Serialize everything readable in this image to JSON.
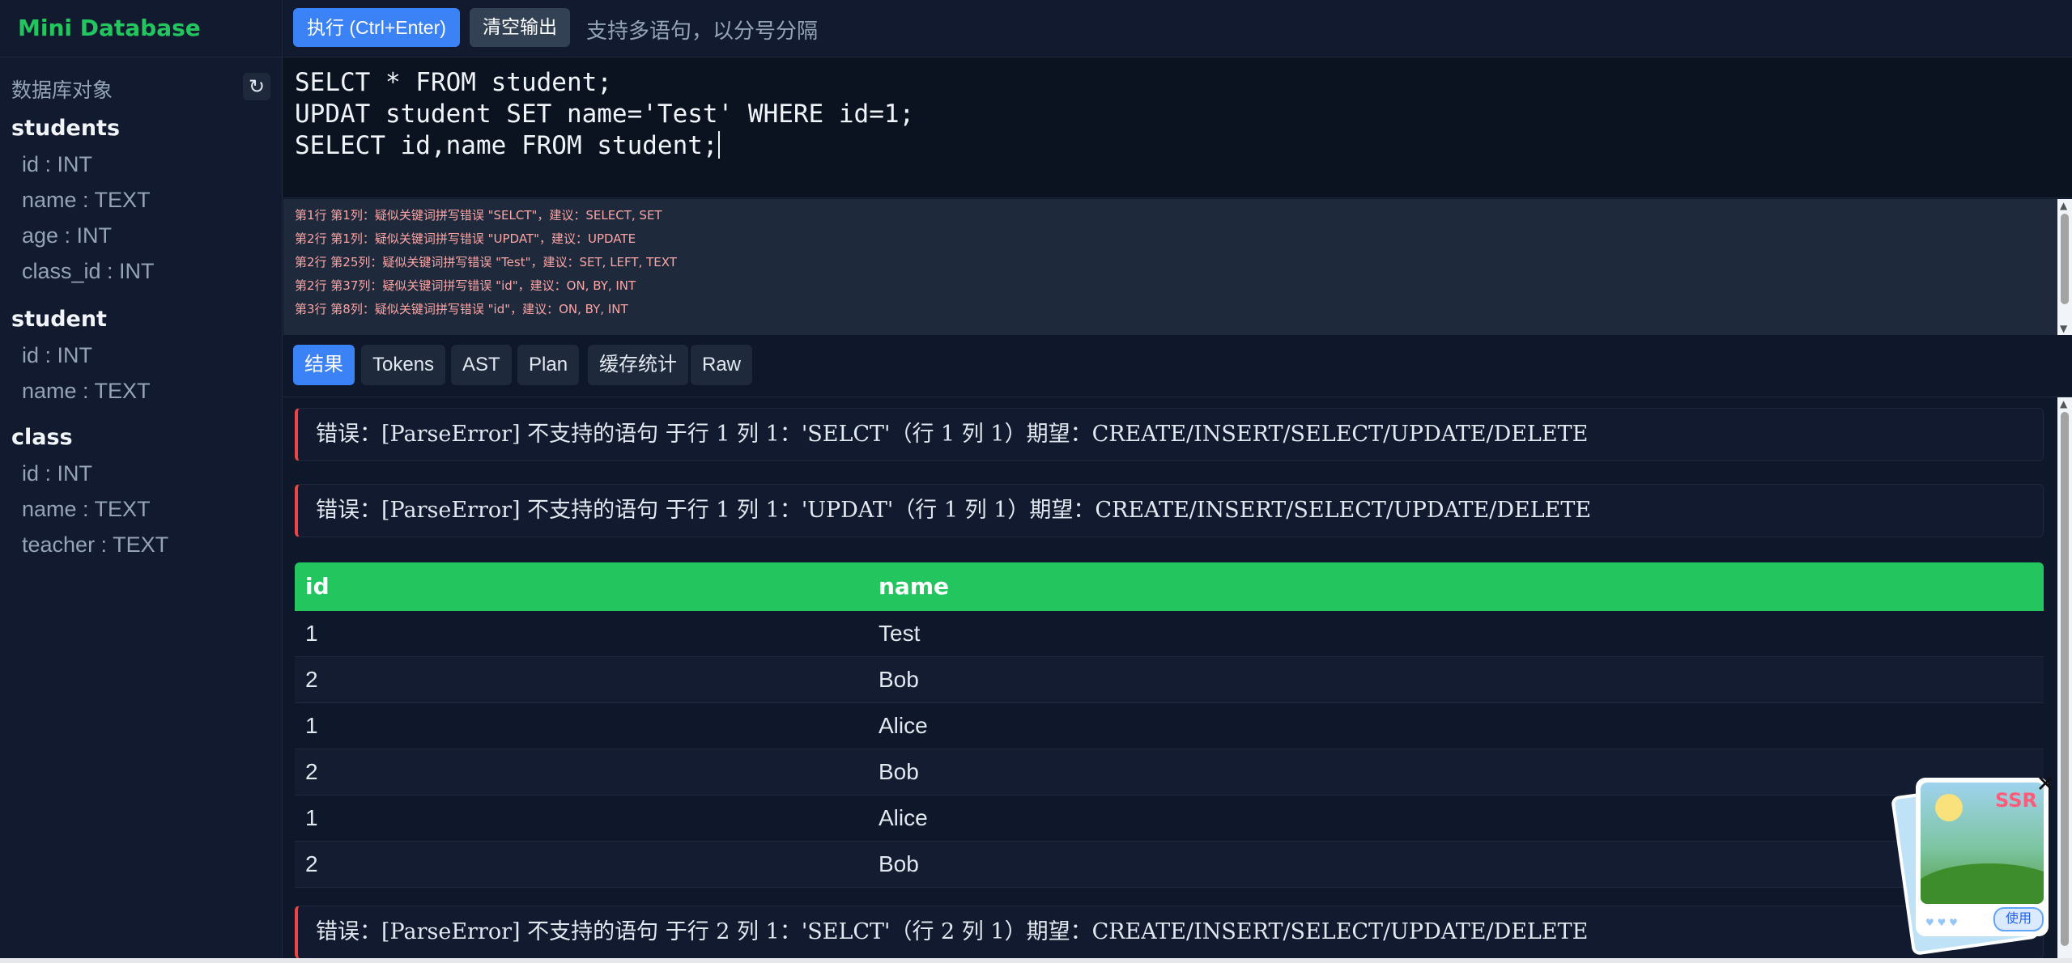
{
  "app": {
    "title": "Mini Database"
  },
  "sidebar": {
    "header": "数据库对象",
    "refresh_icon": "↻",
    "tables": [
      {
        "name": "students",
        "columns": [
          "id : INT",
          "name : TEXT",
          "age : INT",
          "class_id : INT"
        ]
      },
      {
        "name": "student",
        "columns": [
          "id : INT",
          "name : TEXT"
        ]
      },
      {
        "name": "class",
        "columns": [
          "id : INT",
          "name : TEXT",
          "teacher : TEXT"
        ]
      }
    ]
  },
  "toolbar": {
    "run_label": "执行 (Ctrl+Enter)",
    "clear_label": "清空输出",
    "hint": "支持多语句，以分号分隔"
  },
  "editor": {
    "lines": [
      "SELCT * FROM student;",
      "UPDAT student SET name='Test' WHERE id=1;",
      "SELECT id,name FROM student;"
    ]
  },
  "diagnostics": [
    "第1行 第1列：疑似关键词拼写错误 \"SELCT\"，建议：SELECT, SET",
    "第2行 第1列：疑似关键词拼写错误 \"UPDAT\"，建议：UPDATE",
    "第2行 第25列：疑似关键词拼写错误 \"Test\"，建议：SET, LEFT, TEXT",
    "第2行 第37列：疑似关键词拼写错误 \"id\"，建议：ON, BY, INT",
    "第3行 第8列：疑似关键词拼写错误 \"id\"，建议：ON, BY, INT"
  ],
  "tabs": [
    "结果",
    "Tokens",
    "AST",
    "Plan",
    "缓存统计",
    "Raw"
  ],
  "active_tab": "结果",
  "results": {
    "errors": [
      "错误：[ParseError] 不支持的语句 于行 1 列 1：'SELCT'（行 1 列 1）期望：CREATE/INSERT/SELECT/UPDATE/DELETE",
      "错误：[ParseError] 不支持的语句 于行 1 列 1：'UPDAT'（行 1 列 1）期望：CREATE/INSERT/SELECT/UPDATE/DELETE",
      "错误：[ParseError] 不支持的语句 于行 2 列 1：'SELCT'（行 2 列 1）期望：CREATE/INSERT/SELECT/UPDATE/DELETE"
    ],
    "table": {
      "columns": [
        "id",
        "name"
      ],
      "rows": [
        [
          "1",
          "Test"
        ],
        [
          "2",
          "Bob"
        ],
        [
          "1",
          "Alice"
        ],
        [
          "2",
          "Bob"
        ],
        [
          "1",
          "Alice"
        ],
        [
          "2",
          "Bob"
        ]
      ]
    }
  },
  "widget": {
    "badge": "SSR",
    "use_label": "使用",
    "close": "✕",
    "hearts": "♥ ♥ ♥"
  },
  "colors": {
    "accent": "#3b82f6",
    "brand": "#22c55e",
    "error": "#ef4444",
    "background": "#0f172a"
  }
}
